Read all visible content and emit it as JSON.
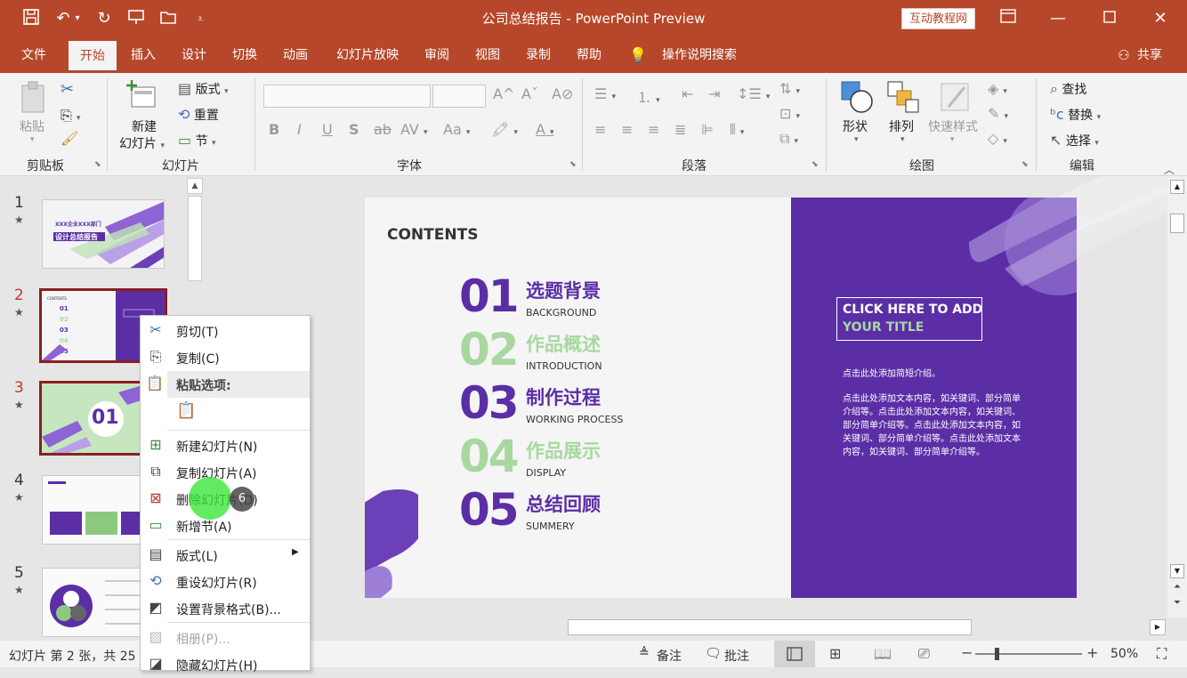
{
  "title": "公司总结报告 - PowerPoint Preview",
  "watermark": "互动教程网",
  "menu": {
    "file": "文件",
    "home": "开始",
    "insert": "插入",
    "design": "设计",
    "transitions": "切换",
    "animations": "动画",
    "slideshow": "幻灯片放映",
    "review": "审阅",
    "view": "视图",
    "record": "录制",
    "help": "帮助",
    "tellme": "操作说明搜索",
    "share": "共享"
  },
  "ribbon": {
    "clipboard": {
      "label": "剪贴板",
      "paste": "粘贴"
    },
    "slides": {
      "label": "幻灯片",
      "new_slide_1": "新建",
      "new_slide_2": "幻灯片",
      "layout": "版式",
      "reset": "重置",
      "section": "节"
    },
    "font": {
      "label": "字体"
    },
    "paragraph": {
      "label": "段落"
    },
    "drawing": {
      "label": "绘图",
      "shapes": "形状",
      "arrange": "排列",
      "quick_styles": "快速样式"
    },
    "editing": {
      "label": "编辑",
      "find": "查找",
      "replace": "替换",
      "select": "选择"
    }
  },
  "thumbnails": [
    {
      "num": "1",
      "title1": "XXX企业XXX部门",
      "title2": "设计总结报告"
    },
    {
      "num": "2"
    },
    {
      "num": "3",
      "big": "01"
    },
    {
      "num": "4"
    },
    {
      "num": "5"
    }
  ],
  "slide": {
    "contents": "CONTENTS",
    "items": [
      {
        "num": "01",
        "title": "选题背景",
        "sub": "BACKGROUND",
        "color": "#5b2ea6"
      },
      {
        "num": "02",
        "title": "作品概述",
        "sub": "INTRODUCTION",
        "color": "#a8d8a0"
      },
      {
        "num": "03",
        "title": "制作过程",
        "sub": "WORKING PROCESS",
        "color": "#5b2ea6"
      },
      {
        "num": "04",
        "title": "作品展示",
        "sub": "DISPLAY",
        "color": "#a8d8a0"
      },
      {
        "num": "05",
        "title": "总结回顾",
        "sub": "SUMMERY",
        "color": "#5b2ea6"
      }
    ],
    "click_title_1": "CLICK HERE TO ADD",
    "click_title_2": "YOUR TITLE",
    "intro": "点击此处添加简短介绍。",
    "body": "点击此处添加文本内容，如关键词、部分简单介绍等。点击此处添加文本内容，如关键词、部分简单介绍等。点击此处添加文本内容，如关键词、部分简单介绍等。点击此处添加文本内容，如关键词、部分简单介绍等。"
  },
  "context_menu": {
    "cut": "剪切(T)",
    "copy": "复制(C)",
    "paste_options": "粘贴选项:",
    "new_slide": "新建幻灯片(N)",
    "duplicate": "复制幻灯片(A)",
    "delete": "删除幻灯片(D)",
    "add_section": "新增节(A)",
    "layout": "版式(L)",
    "reset": "重设幻灯片(R)",
    "format_bg": "设置背景格式(B)...",
    "album": "相册(P)...",
    "hide": "隐藏幻灯片(H)"
  },
  "click_badge": "6",
  "status": {
    "slide_info": "幻灯片 第 2 张，共 25",
    "notes": "备注",
    "comments": "批注",
    "zoom": "50%"
  }
}
